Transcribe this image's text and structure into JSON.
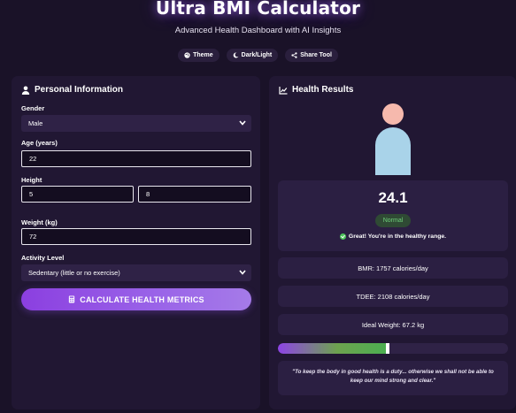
{
  "header": {
    "title": "Ultra BMI Calculator",
    "subtitle": "Advanced Health Dashboard with AI Insights",
    "buttons": [
      {
        "label": "Theme",
        "icon": "palette-icon"
      },
      {
        "label": "Dark/Light",
        "icon": "moon-icon"
      },
      {
        "label": "Share Tool",
        "icon": "share-icon"
      }
    ]
  },
  "form": {
    "title": "Personal Information",
    "title_icon": "user-icon",
    "gender_label": "Gender",
    "gender_value": "Male",
    "age_label": "Age (years)",
    "age_value": "22",
    "height_label": "Height",
    "height_feet": "5",
    "height_inches": "8",
    "weight_label": "Weight (kg)",
    "weight_value": "72",
    "activity_label": "Activity Level",
    "activity_value": "Sedentary (little or no exercise)",
    "calculate_label": "CALCULATE HEALTH METRICS",
    "calculate_icon": "calculator-icon"
  },
  "results": {
    "title": "Health Results",
    "title_icon": "chart-line-icon",
    "bmi_value": "24.1",
    "category": "Normal",
    "message": "Great! You're in the healthy range.",
    "bmr": "BMR: 1757 calories/day",
    "tdee": "TDEE: 2108 calories/day",
    "ideal_weight": "Ideal Weight: 67.2 kg",
    "bmi_scale_fill_fraction": 0.47,
    "quote": "\"To keep the body in good health is a duty... otherwise we shall not be able to keep our mind strong and clear.\""
  },
  "colors": {
    "background": "#1a1228",
    "panel": "#211733",
    "accent": "#8b3fe0",
    "healthy_green": "#4caf50",
    "avatar_head": "#f6b9ad",
    "avatar_body": "#a9d3e9"
  }
}
